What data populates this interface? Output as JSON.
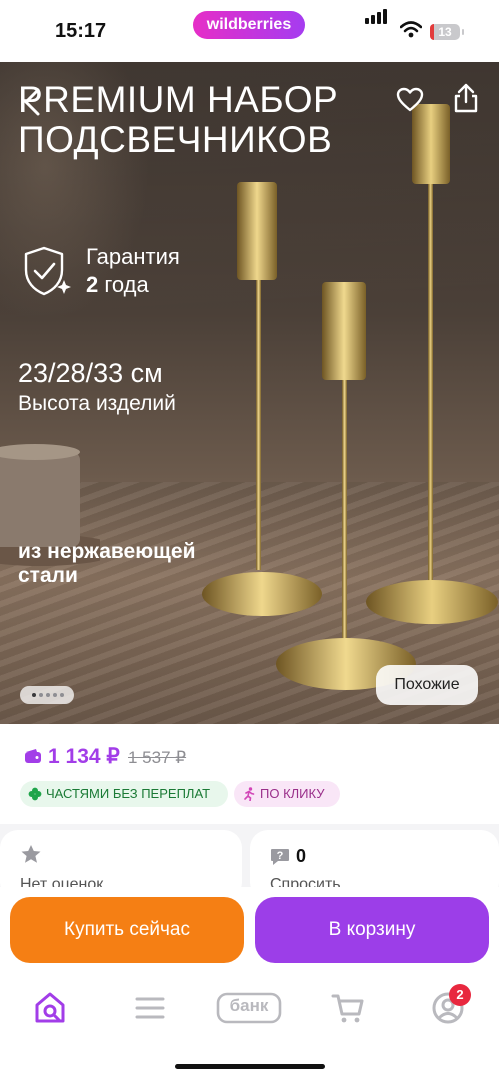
{
  "status_bar": {
    "time": "15:17",
    "brand": "wildberries",
    "battery": "13"
  },
  "hero": {
    "title_line1": "PREMIUM НАБОР",
    "title_line2": "ПОДСВЕЧНИКОВ",
    "guarantee_label": "Гарантия",
    "guarantee_number": "2",
    "guarantee_unit": "года",
    "height_value": "23/28/33 см",
    "height_label": "Высота изделий",
    "material": "из нержавеющей стали",
    "similar_button": "Похожие",
    "gallery_dots": 5
  },
  "price": {
    "current": "1 134 ₽",
    "old": "1 537 ₽",
    "badge_installments": "ЧАСТЯМИ БЕЗ ПЕРЕПЛАТ",
    "badge_one_click": "ПО КЛИКУ",
    "accent_color": "#a23de8"
  },
  "cards": {
    "rating_text": "Нет оценок",
    "questions_count": "0",
    "questions_text": "Спросить"
  },
  "actions": {
    "buy_now": "Купить сейчас",
    "add_to_cart": "В корзину"
  },
  "tabbar": {
    "items": [
      "home-search-icon",
      "menu-icon",
      "bank-icon",
      "cart-icon",
      "profile-icon"
    ],
    "bank_label": "банк",
    "profile_badge": "2"
  }
}
